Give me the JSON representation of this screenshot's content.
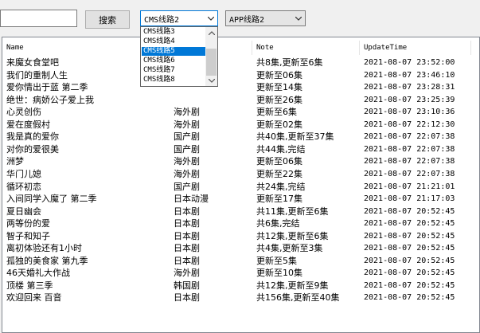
{
  "search": {
    "value": "",
    "button_label": "搜索"
  },
  "cms_select": {
    "selected": "CMS线路2",
    "options_visible": [
      "CMS线路3",
      "CMS线路4",
      "CMS线路5",
      "CMS线路6",
      "CMS线路7",
      "CMS线路8"
    ],
    "highlighted_index": 2
  },
  "app_select": {
    "selected": "APP线路2"
  },
  "table": {
    "columns": [
      "Name",
      "",
      "Note",
      "UpdateTime"
    ],
    "rows": [
      [
        "来魔女食堂吧",
        "",
        "共8集,更新至6集",
        "2021-08-07 23:52:00"
      ],
      [
        "我们的重制人生",
        "",
        "更新至06集",
        "2021-08-07 23:46:10"
      ],
      [
        "爱你情出于蓝 第二季",
        "",
        "更新至14集",
        "2021-08-07 23:28:31"
      ],
      [
        "绝世：病娇公子爱上我",
        "",
        "更新至26集",
        "2021-08-07 23:25:39"
      ],
      [
        "心灵创伤",
        "海外剧",
        "更新至6集",
        "2021-08-07 23:10:36"
      ],
      [
        "爱在度假村",
        "海外剧",
        "更新至02集",
        "2021-08-07 22:12:30"
      ],
      [
        "我是真的爱你",
        "国产剧",
        "共40集,更新至37集",
        "2021-08-07 22:07:38"
      ],
      [
        "对你的爱很美",
        "国产剧",
        "共44集,完结",
        "2021-08-07 22:07:38"
      ],
      [
        "洲梦",
        "海外剧",
        "更新至06集",
        "2021-08-07 22:07:38"
      ],
      [
        "华门儿媳",
        "海外剧",
        "更新至22集",
        "2021-08-07 22:07:38"
      ],
      [
        "循环初恋",
        "国产剧",
        "共24集,完结",
        "2021-08-07 21:21:01"
      ],
      [
        "入间同学入魔了 第二季",
        "日本动漫",
        "更新至17集",
        "2021-08-07 21:17:03"
      ],
      [
        "夏日幽会",
        "日本剧",
        "共11集,更新至6集",
        "2021-08-07 20:52:45"
      ],
      [
        "两等份的爱",
        "日本剧",
        "共6集,完结",
        "2021-08-07 20:52:45"
      ],
      [
        "智子和知子",
        "日本剧",
        "共12集,更新至6集",
        "2021-08-07 20:52:45"
      ],
      [
        "离初体验还有1小时",
        "日本剧",
        "共4集,更新至3集",
        "2021-08-07 20:52:45"
      ],
      [
        "孤独的美食家 第九季",
        "日本剧",
        "更新至5集",
        "2021-08-07 20:52:45"
      ],
      [
        "46天婚礼大作战",
        "海外剧",
        "更新至10集",
        "2021-08-07 20:52:45"
      ],
      [
        "顶楼 第三季",
        "韩国剧",
        "共12集,更新至9集",
        "2021-08-07 20:52:45"
      ],
      [
        "欢迎回来 百音",
        "日本剧",
        "共156集,更新至40集",
        "2021-08-07 20:52:45"
      ]
    ]
  },
  "icons": {
    "dropdown_arrow": "chevron-down-icon",
    "scroll_up": "chevron-up-icon",
    "scroll_down": "chevron-down-icon"
  }
}
